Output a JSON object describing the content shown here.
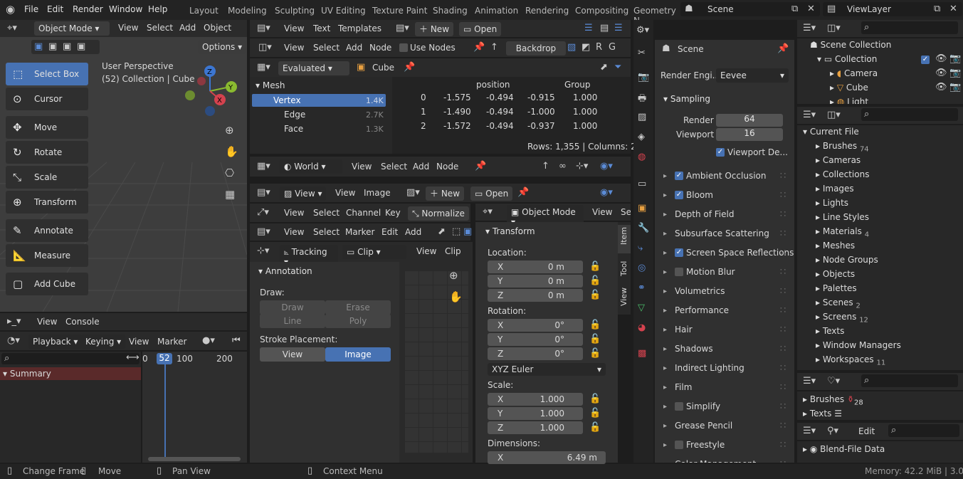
{
  "topbar": {
    "menus": [
      "File",
      "Edit",
      "Render",
      "Window",
      "Help"
    ],
    "workspaces": [
      "Layout",
      "Modeling",
      "Sculpting",
      "UV Editing",
      "Texture Paint",
      "Shading",
      "Animation",
      "Rendering",
      "Compositing",
      "Geometry N"
    ],
    "scene": "Scene",
    "view_layer": "ViewLayer"
  },
  "viewport": {
    "mode": "Object Mode",
    "menus": [
      "View",
      "Select",
      "Add",
      "Object"
    ],
    "options": "Options",
    "perspective": "User Perspective",
    "collection_info": "(52) Collection | Cube",
    "tools": [
      "Select Box",
      "Cursor",
      "Move",
      "Rotate",
      "Scale",
      "Transform",
      "Annotate",
      "Measure",
      "Add Cube"
    ],
    "gizmo": {
      "z": "Z",
      "y": "Y",
      "x": "X"
    }
  },
  "text_editor": {
    "menus": [
      "View",
      "Text",
      "Templates"
    ],
    "new": "New",
    "open": "Open"
  },
  "node_editor": {
    "menus": [
      "View",
      "Select",
      "Add",
      "Node"
    ],
    "use_nodes": "Use Nodes",
    "backdrop": "Backdrop"
  },
  "spreadsheet": {
    "evaluated": "Evaluated",
    "object": "Cube",
    "tree": [
      {
        "label": "Mesh"
      },
      {
        "label": "Vertex",
        "count": "1.4K"
      },
      {
        "label": "Edge",
        "count": "2.7K"
      },
      {
        "label": "Face",
        "count": "1.3K"
      }
    ],
    "headers": {
      "position": "position",
      "group": "Group"
    },
    "rows": [
      {
        "idx": "0",
        "x": "-1.575",
        "y": "-0.494",
        "z": "-0.915",
        "g": "1.000"
      },
      {
        "idx": "1",
        "x": "-1.490",
        "y": "-0.494",
        "z": "-1.000",
        "g": "1.000"
      },
      {
        "idx": "2",
        "x": "-1.572",
        "y": "-0.494",
        "z": "-0.937",
        "g": "1.000"
      }
    ],
    "footer": "Rows: 1,355   |   Columns: 2"
  },
  "world_editor": {
    "world": "World",
    "menus": [
      "View",
      "Select",
      "Add",
      "Node"
    ]
  },
  "image_editor": {
    "view": "View",
    "menus": [
      "View",
      "Image"
    ],
    "new": "New",
    "open": "Open"
  },
  "graph_editor": {
    "menus": [
      "View",
      "Select",
      "Channel",
      "Key"
    ],
    "normalize": "Normalize"
  },
  "clip_header": {
    "menus": [
      "View",
      "Select",
      "Marker",
      "Edit",
      "Add"
    ]
  },
  "clip_editor": {
    "tracking": "Tracking",
    "clip": "Clip",
    "menus": [
      "View",
      "Clip"
    ],
    "annotation": "Annotation",
    "draw": "Draw:",
    "draw_btns": [
      "Draw",
      "Erase",
      "Line",
      "Poly"
    ],
    "stroke": "Stroke Placement:",
    "stroke_btns": [
      "View",
      "Image"
    ]
  },
  "properties_3d": {
    "mode": "Object Mode",
    "menus": [
      "View",
      "Sel"
    ],
    "transform": "Transform",
    "location": "Location:",
    "rotation": "Rotation:",
    "scale": "Scale:",
    "dimensions": "Dimensions:",
    "loc": [
      "0 m",
      "0 m",
      "0 m"
    ],
    "rot": [
      "0°",
      "0°",
      "0°"
    ],
    "euler": "XYZ Euler",
    "scl": [
      "1.000",
      "1.000",
      "1.000"
    ],
    "dim_x": "6.49 m",
    "axes": [
      "X",
      "Y",
      "Z"
    ],
    "tabs": [
      "Item",
      "Tool",
      "View"
    ]
  },
  "render_props": {
    "scene": "Scene",
    "engine_label": "Render Engi...",
    "engine": "Eevee",
    "sampling": "Sampling",
    "render_label": "Render",
    "render_val": "64",
    "viewport_label": "Viewport",
    "viewport_val": "16",
    "viewport_denoise": "Viewport De...",
    "panels": [
      {
        "label": "Ambient Occlusion",
        "check": "on"
      },
      {
        "label": "Bloom",
        "check": "on"
      },
      {
        "label": "Depth of Field",
        "check": "none"
      },
      {
        "label": "Subsurface Scattering",
        "check": "none"
      },
      {
        "label": "Screen Space Reflections",
        "check": "on"
      },
      {
        "label": "Motion Blur",
        "check": "off"
      },
      {
        "label": "Volumetrics",
        "check": "none"
      },
      {
        "label": "Performance",
        "check": "none"
      },
      {
        "label": "Hair",
        "check": "none"
      },
      {
        "label": "Shadows",
        "check": "none"
      },
      {
        "label": "Indirect Lighting",
        "check": "none"
      },
      {
        "label": "Film",
        "check": "none"
      },
      {
        "label": "Simplify",
        "check": "off"
      },
      {
        "label": "Grease Pencil",
        "check": "none"
      },
      {
        "label": "Freestyle",
        "check": "off"
      },
      {
        "label": "Color Management",
        "check": "none"
      }
    ]
  },
  "outliner": {
    "scene_collection": "Scene Collection",
    "items": [
      "Collection",
      "Camera",
      "Cube",
      "Light"
    ]
  },
  "file_browser": {
    "root": "Current File",
    "items": [
      {
        "label": "Brushes",
        "badge": "74"
      },
      {
        "label": "Cameras",
        "badge": ""
      },
      {
        "label": "Collections",
        "badge": ""
      },
      {
        "label": "Images",
        "badge": ""
      },
      {
        "label": "Lights",
        "badge": ""
      },
      {
        "label": "Line Styles",
        "badge": ""
      },
      {
        "label": "Materials",
        "badge": "4"
      },
      {
        "label": "Meshes",
        "badge": ""
      },
      {
        "label": "Node Groups",
        "badge": ""
      },
      {
        "label": "Objects",
        "badge": ""
      },
      {
        "label": "Palettes",
        "badge": ""
      },
      {
        "label": "Scenes",
        "badge": "2"
      },
      {
        "label": "Screens",
        "badge": "12"
      },
      {
        "label": "Texts",
        "badge": ""
      },
      {
        "label": "Window Managers",
        "badge": ""
      },
      {
        "label": "Workspaces",
        "badge": "11"
      }
    ]
  },
  "orphan": {
    "items": [
      {
        "label": "Brushes",
        "badge": "28"
      },
      {
        "label": "Texts",
        "badge": ""
      }
    ]
  },
  "blend_data": {
    "edit": "Edit",
    "label": "Blend-File Data"
  },
  "console": {
    "menus": [
      "View",
      "Console"
    ]
  },
  "timeline": {
    "menus": [
      "Playback",
      "Keying",
      "View",
      "Marker"
    ],
    "frames": [
      "0",
      "52",
      "100",
      "200"
    ],
    "summary": "Summary"
  },
  "statusbar": {
    "change_frame": "Change Frame",
    "move": "Move",
    "pan_view": "Pan View",
    "context_menu": "Context Menu",
    "memory": "Memory: 42.2 MiB | 3.0.0"
  }
}
